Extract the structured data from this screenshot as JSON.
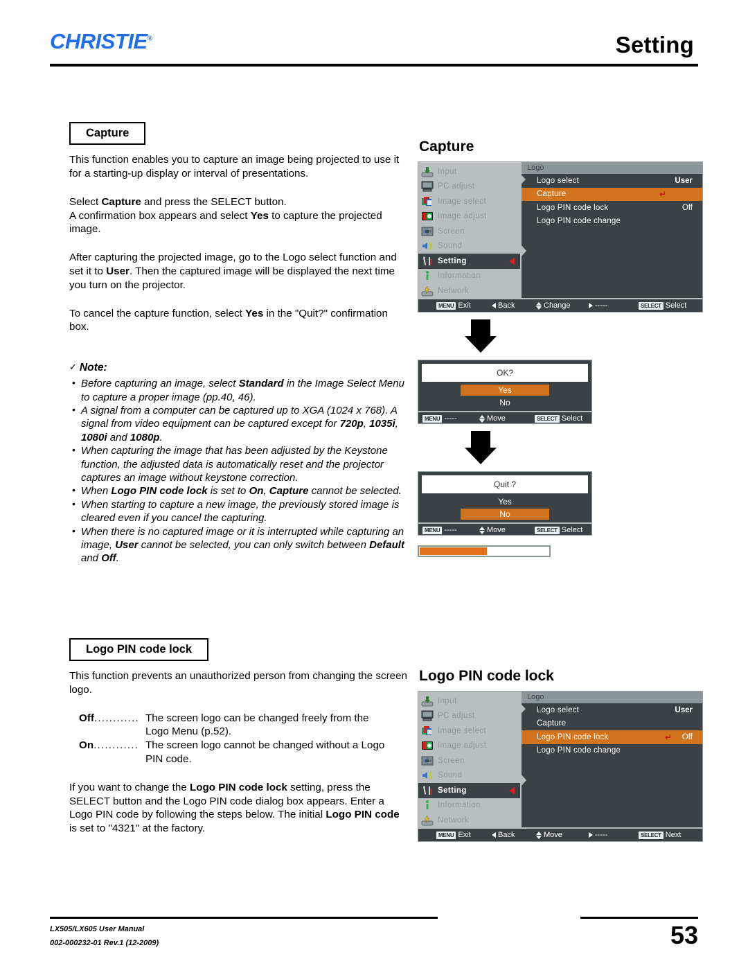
{
  "header": {
    "brand": "CHRISTIE",
    "brand_reg": "®",
    "title": "Setting"
  },
  "left_column": {
    "capture_section": {
      "heading": "Capture",
      "paragraphs": [
        "This function enables you to capture an image being projected to use it for a starting-up display or interval of presentations.",
        "Select Capture and press the SELECT button.",
        "A confirmation box appears and select Yes to capture the projected image.",
        "After capturing the projected image, go to the Logo select function and set it to User. Then the captured image will be displayed the next time you turn on the projector.",
        "To cancel the capture function, select Yes in the \"Quit?\" confirmation box."
      ]
    },
    "note": {
      "check_glyph": "✓",
      "heading": "Note:",
      "items": [
        "Before capturing an image, select Standard in the Image Select Menu to capture a proper image (pp.40, 46).",
        "A signal from a computer can be captured up to XGA (1024 x 768). A signal from video equipment can be captured except for 720p, 1035i, 1080i and 1080p.",
        "When capturing the image that has been adjusted by the Keystone function, the adjusted data is automatically reset and the projector captures an image without keystone correction.",
        "When Logo PIN code lock is set to On, Capture cannot be selected.",
        "When starting to capture a new image, the previously stored image is cleared even if you cancel the capturing.",
        "When there is no captured image or it is interrupted while capturing an image, User cannot be selected, you can only switch between Default and Off."
      ]
    },
    "pin_section": {
      "heading": "Logo PIN code lock",
      "intro": "This function prevents an unauthorized person from changing the screen logo.",
      "definitions": [
        {
          "term": "Off",
          "dots": "............",
          "desc": "The screen logo can be changed freely from the",
          "desc_cont": "Logo Menu (p.52)."
        },
        {
          "term": "On",
          "dots": "............",
          "desc": "The screen logo cannot be changed without a Logo",
          "desc_cont": "PIN code."
        }
      ],
      "closing": "If you want to change the Logo PIN code lock setting, press the SELECT button and the Logo PIN code dialog box appears. Enter a Logo PIN code by following the steps below. The initial Logo PIN code is set to \"4321\" at the factory."
    }
  },
  "right_column": {
    "capture_osd": {
      "title": "Capture",
      "sidebar": [
        {
          "label": "Input",
          "icon": "input-icon",
          "state": "dim"
        },
        {
          "label": "PC adjust",
          "icon": "pc-adjust-icon",
          "state": "dim"
        },
        {
          "label": "Image select",
          "icon": "image-select-icon",
          "state": "dim"
        },
        {
          "label": "Image adjust",
          "icon": "image-adjust-icon",
          "state": "dim"
        },
        {
          "label": "Screen",
          "icon": "screen-icon",
          "state": "dim"
        },
        {
          "label": "Sound",
          "icon": "sound-icon",
          "state": "dim"
        },
        {
          "label": "Setting",
          "icon": "setting-icon",
          "state": "active"
        },
        {
          "label": "Information",
          "icon": "information-icon",
          "state": "dim"
        },
        {
          "label": "Network",
          "icon": "network-icon",
          "state": "dim"
        }
      ],
      "panel_title": "Logo",
      "rows": [
        {
          "name": "Logo select",
          "value": "User",
          "selected": false,
          "enter": false
        },
        {
          "name": "Capture",
          "value": "",
          "selected": true,
          "enter": true
        },
        {
          "name": "Logo PIN code lock",
          "value": "Off",
          "selected": false,
          "enter": false
        },
        {
          "name": "Logo PIN code change",
          "value": "",
          "selected": false,
          "enter": false
        }
      ],
      "footer": [
        {
          "key": "MENU",
          "label": "Exit",
          "glyph": "keycap"
        },
        {
          "key": "",
          "label": "Back",
          "glyph": "tri-left"
        },
        {
          "key": "",
          "label": "Change",
          "glyph": "updown"
        },
        {
          "key": "",
          "label": "-----",
          "glyph": "tri-right"
        },
        {
          "key": "SELECT",
          "label": "Select",
          "glyph": "keycap"
        }
      ]
    },
    "ok_dialog": {
      "question": "OK?",
      "options": [
        {
          "label": "Yes",
          "selected": true
        },
        {
          "label": "No",
          "selected": false
        }
      ],
      "footer": [
        {
          "key": "MENU",
          "label": "-----",
          "glyph": "keycap"
        },
        {
          "key": "",
          "label": "Move",
          "glyph": "updown"
        },
        {
          "key": "SELECT",
          "label": "Select",
          "glyph": "keycap"
        }
      ]
    },
    "quit_dialog": {
      "question": "Quit ?",
      "options": [
        {
          "label": "Yes",
          "selected": false
        },
        {
          "label": "No",
          "selected": true
        }
      ],
      "footer": [
        {
          "key": "MENU",
          "label": "-----",
          "glyph": "keycap"
        },
        {
          "key": "",
          "label": "Move",
          "glyph": "updown"
        },
        {
          "key": "SELECT",
          "label": "Select",
          "glyph": "keycap"
        }
      ]
    },
    "progress": {
      "percent": 52
    },
    "pin_osd": {
      "title": "Logo PIN code lock",
      "sidebar": [
        {
          "label": "Input",
          "icon": "input-icon",
          "state": "dim"
        },
        {
          "label": "PC adjust",
          "icon": "pc-adjust-icon",
          "state": "dim"
        },
        {
          "label": "Image select",
          "icon": "image-select-icon",
          "state": "dim"
        },
        {
          "label": "Image adjust",
          "icon": "image-adjust-icon",
          "state": "dim"
        },
        {
          "label": "Screen",
          "icon": "screen-icon",
          "state": "dim"
        },
        {
          "label": "Sound",
          "icon": "sound-icon",
          "state": "dim"
        },
        {
          "label": "Setting",
          "icon": "setting-icon",
          "state": "active"
        },
        {
          "label": "Information",
          "icon": "information-icon",
          "state": "dim"
        },
        {
          "label": "Network",
          "icon": "network-icon",
          "state": "dim"
        }
      ],
      "panel_title": "Logo",
      "rows": [
        {
          "name": "Logo select",
          "value": "User",
          "selected": false,
          "enter": false
        },
        {
          "name": "Capture",
          "value": "",
          "selected": false,
          "enter": false
        },
        {
          "name": "Logo PIN code lock",
          "value": "Off",
          "selected": true,
          "enter": true
        },
        {
          "name": "Logo PIN code change",
          "value": "",
          "selected": false,
          "enter": false
        }
      ],
      "footer": [
        {
          "key": "MENU",
          "label": "Exit",
          "glyph": "keycap"
        },
        {
          "key": "",
          "label": "Back",
          "glyph": "tri-left"
        },
        {
          "key": "",
          "label": "Move",
          "glyph": "updown"
        },
        {
          "key": "",
          "label": "-----",
          "glyph": "tri-right"
        },
        {
          "key": "SELECT",
          "label": "Next",
          "glyph": "keycap"
        }
      ]
    }
  },
  "footer": {
    "manual": "LX505/LX605 User Manual",
    "docid": "002-000232-01 Rev.1 (12-2009)",
    "page": "53"
  }
}
